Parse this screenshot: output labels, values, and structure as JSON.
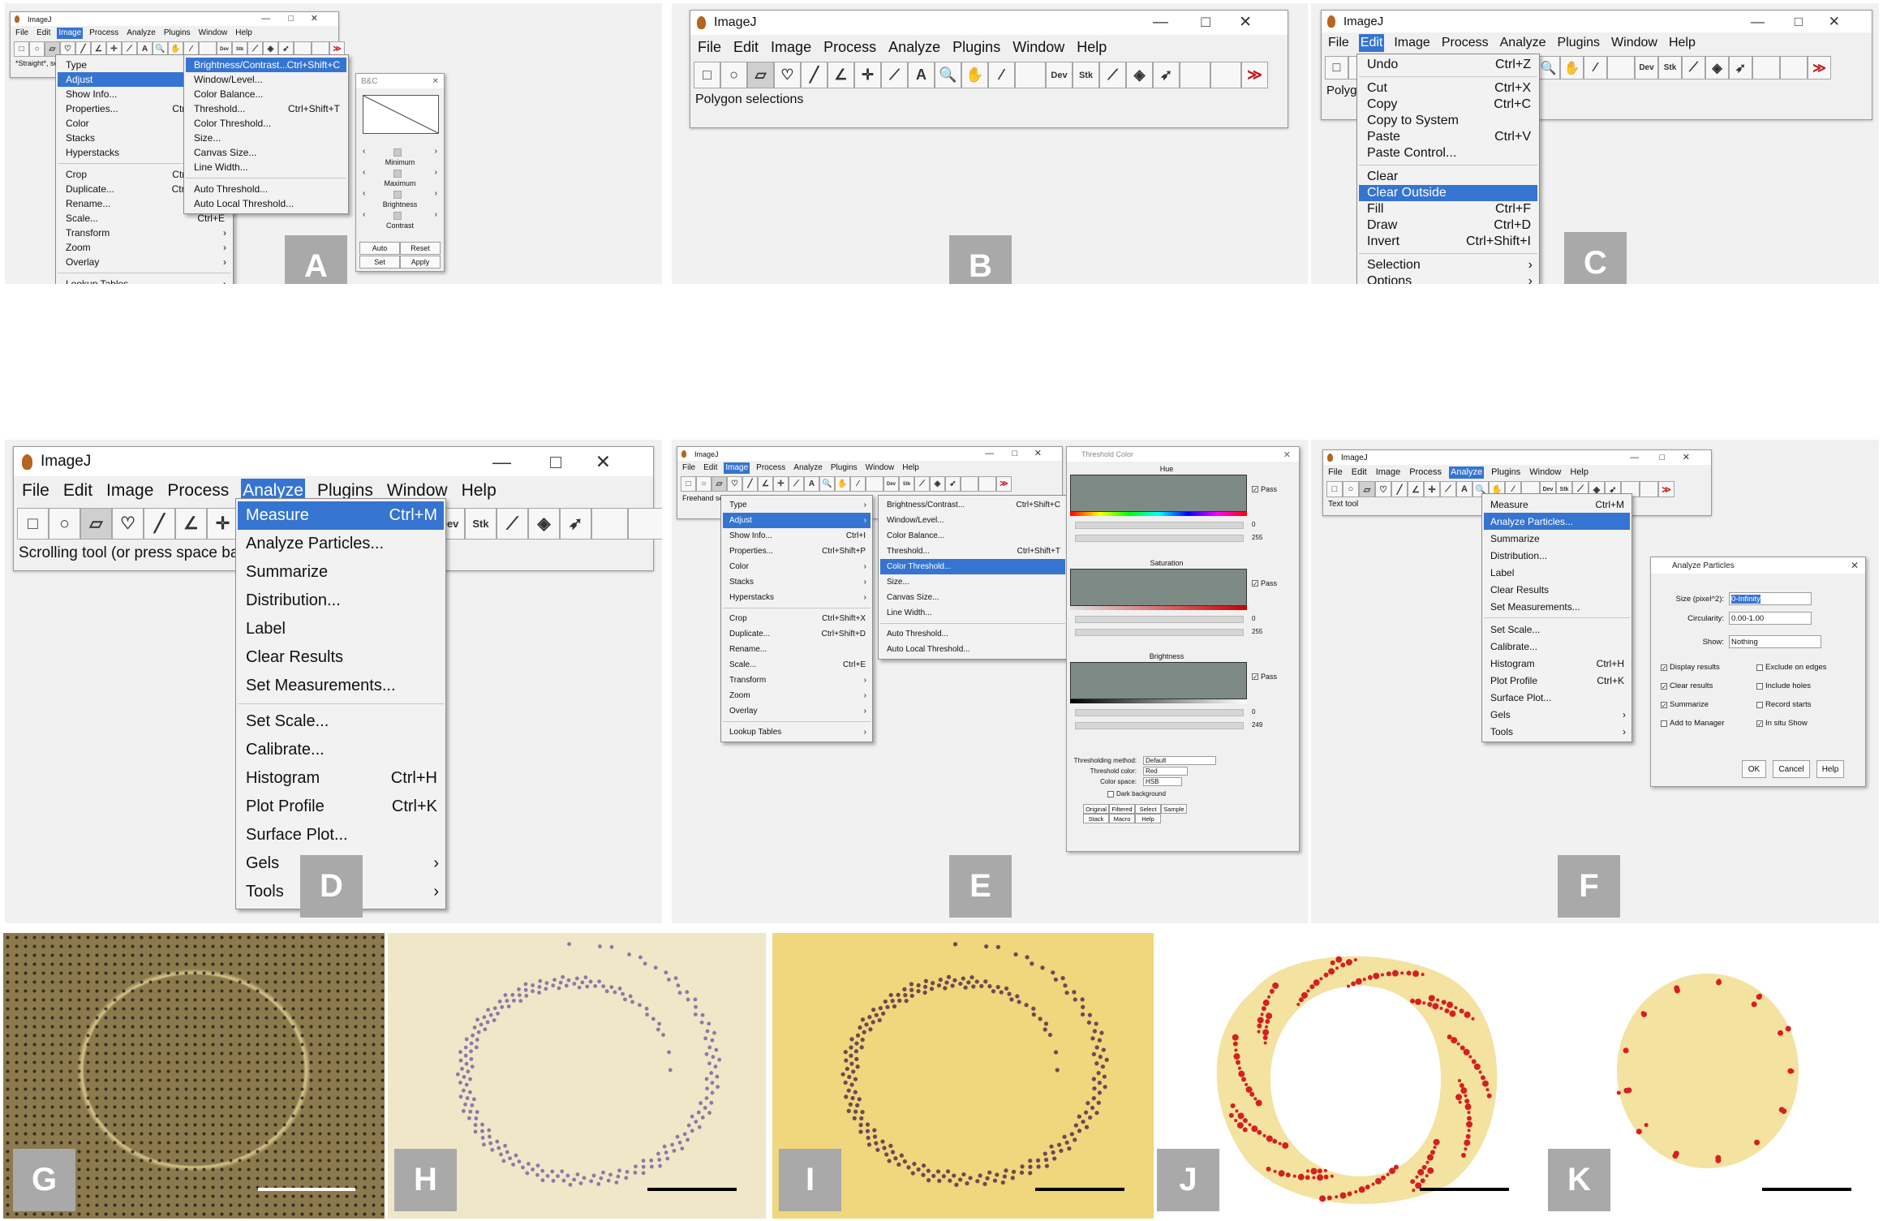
{
  "panels": {
    "a": "A",
    "b": "B",
    "c": "C",
    "d": "D",
    "e": "E",
    "f": "F",
    "g": "G",
    "h": "H",
    "i": "I",
    "j": "J",
    "k": "K"
  },
  "app": {
    "title": "ImageJ",
    "minimize": "—",
    "maximize": "□",
    "close": "✕"
  },
  "menubar": [
    "File",
    "Edit",
    "Image",
    "Process",
    "Analyze",
    "Plugins",
    "Window",
    "Help"
  ],
  "tools": {
    "rect": "□",
    "oval": "○",
    "poly": "▱",
    "freehand": "♡",
    "line": "╱",
    "angle": "∠",
    "point": "✛",
    "wand": "⟋",
    "text": "A",
    "zoom": "🔍",
    "hand": "✋",
    "dropper": "⁄",
    "dev": "Dev",
    "stk": "Stk",
    "brush": "⟋",
    "flood": "◈",
    "pick": "➶",
    "more": "≫"
  },
  "a": {
    "status": "*Straight*, se",
    "image_menu": [
      {
        "label": "Type",
        "arrow": "›"
      },
      {
        "label": "Adjust",
        "arrow": "›",
        "hl": true
      },
      {
        "label": "Show Info...",
        "sc": "Ctrl+I"
      },
      {
        "label": "Properties...",
        "sc": "Ctrl+Shift+P"
      },
      {
        "label": "Color",
        "arrow": "›"
      },
      {
        "label": "Stacks",
        "arrow": "›"
      },
      {
        "label": "Hyperstacks",
        "arrow": "›"
      },
      {
        "sep": true
      },
      {
        "label": "Crop",
        "sc": "Ctrl+Shift+X"
      },
      {
        "label": "Duplicate...",
        "sc": "Ctrl+Shift+D"
      },
      {
        "label": "Rename..."
      },
      {
        "label": "Scale...",
        "sc": "Ctrl+E"
      },
      {
        "label": "Transform",
        "arrow": "›"
      },
      {
        "label": "Zoom",
        "arrow": "›"
      },
      {
        "label": "Overlay",
        "arrow": "›"
      },
      {
        "sep": true
      },
      {
        "label": "Lookup Tables",
        "arrow": "›"
      }
    ],
    "adjust_menu": [
      {
        "label": "Brightness/Contrast...",
        "sc": "Ctrl+Shift+C",
        "hl": true
      },
      {
        "label": "Window/Level..."
      },
      {
        "label": "Color Balance..."
      },
      {
        "label": "Threshold...",
        "sc": "Ctrl+Shift+T"
      },
      {
        "label": "Color Threshold..."
      },
      {
        "label": "Size..."
      },
      {
        "label": "Canvas Size..."
      },
      {
        "label": "Line Width..."
      },
      {
        "sep": true
      },
      {
        "label": "Auto Threshold..."
      },
      {
        "label": "Auto Local Threshold..."
      }
    ],
    "bc": {
      "title": "B&C",
      "minimum": "Minimum",
      "maximum": "Maximum",
      "brightness": "Brightness",
      "contrast": "Contrast",
      "auto": "Auto",
      "reset": "Reset",
      "set": "Set",
      "apply": "Apply",
      "lt": "‹",
      "gt": "›"
    }
  },
  "b": {
    "status": "Polygon selections"
  },
  "c": {
    "status": "Polygo",
    "edit_menu": [
      {
        "label": "Undo",
        "sc": "Ctrl+Z"
      },
      {
        "sep": true
      },
      {
        "label": "Cut",
        "sc": "Ctrl+X"
      },
      {
        "label": "Copy",
        "sc": "Ctrl+C"
      },
      {
        "label": "Copy to System"
      },
      {
        "label": "Paste",
        "sc": "Ctrl+V"
      },
      {
        "label": "Paste Control..."
      },
      {
        "sep": true
      },
      {
        "label": "Clear"
      },
      {
        "label": "Clear Outside",
        "hl": true
      },
      {
        "label": "Fill",
        "sc": "Ctrl+F"
      },
      {
        "label": "Draw",
        "sc": "Ctrl+D"
      },
      {
        "label": "Invert",
        "sc": "Ctrl+Shift+I"
      },
      {
        "sep": true
      },
      {
        "label": "Selection",
        "arrow": "›"
      },
      {
        "label": "Options",
        "arrow": "›"
      }
    ]
  },
  "d": {
    "status": "Scrolling tool (or press space bar a",
    "analyze_menu": [
      {
        "label": "Measure",
        "sc": "Ctrl+M",
        "hl": true
      },
      {
        "label": "Analyze Particles..."
      },
      {
        "label": "Summarize"
      },
      {
        "label": "Distribution..."
      },
      {
        "label": "Label"
      },
      {
        "label": "Clear Results"
      },
      {
        "label": "Set Measurements..."
      },
      {
        "sep": true
      },
      {
        "label": "Set Scale..."
      },
      {
        "label": "Calibrate..."
      },
      {
        "label": "Histogram",
        "sc": "Ctrl+H"
      },
      {
        "label": "Plot Profile",
        "sc": "Ctrl+K"
      },
      {
        "label": "Surface Plot..."
      },
      {
        "label": "Gels",
        "arrow": "›"
      },
      {
        "label": "Tools",
        "arrow": "›"
      }
    ]
  },
  "e": {
    "status": "Freehand sel",
    "image_menu": [
      {
        "label": "Type",
        "arrow": "›"
      },
      {
        "label": "Adjust",
        "arrow": "›",
        "hl": true
      },
      {
        "label": "Show Info...",
        "sc": "Ctrl+I"
      },
      {
        "label": "Properties...",
        "sc": "Ctrl+Shift+P"
      },
      {
        "label": "Color",
        "arrow": "›"
      },
      {
        "label": "Stacks",
        "arrow": "›"
      },
      {
        "label": "Hyperstacks",
        "arrow": "›"
      },
      {
        "sep": true
      },
      {
        "label": "Crop",
        "sc": "Ctrl+Shift+X"
      },
      {
        "label": "Duplicate...",
        "sc": "Ctrl+Shift+D"
      },
      {
        "label": "Rename..."
      },
      {
        "label": "Scale...",
        "sc": "Ctrl+E"
      },
      {
        "label": "Transform",
        "arrow": "›"
      },
      {
        "label": "Zoom",
        "arrow": "›"
      },
      {
        "label": "Overlay",
        "arrow": "›"
      },
      {
        "sep": true
      },
      {
        "label": "Lookup Tables",
        "arrow": "›"
      }
    ],
    "adjust_menu": [
      {
        "label": "Brightness/Contrast...",
        "sc": "Ctrl+Shift+C"
      },
      {
        "label": "Window/Level..."
      },
      {
        "label": "Color Balance..."
      },
      {
        "label": "Threshold...",
        "sc": "Ctrl+Shift+T"
      },
      {
        "label": "Color Threshold...",
        "hl": true
      },
      {
        "label": "Size..."
      },
      {
        "label": "Canvas Size..."
      },
      {
        "label": "Line Width..."
      },
      {
        "sep": true
      },
      {
        "label": "Auto Threshold..."
      },
      {
        "label": "Auto Local Threshold..."
      }
    ],
    "ct": {
      "title": "Threshold Color",
      "hue": "Hue",
      "saturation": "Saturation",
      "brightness": "Brightness",
      "pass": "Pass",
      "zero": "0",
      "v255": "255",
      "v249": "249",
      "method_lbl": "Thresholding method:",
      "method": "Default",
      "color_lbl": "Threshold color:",
      "color": "Red",
      "space_lbl": "Color space:",
      "space": "HSB",
      "dark": "Dark background",
      "b_original": "Original",
      "b_filtered": "Filtered",
      "b_select": "Select",
      "b_sample": "Sample",
      "b_stack": "Stack",
      "b_macro": "Macro",
      "b_help": "Help"
    }
  },
  "f": {
    "status": "Text tool",
    "analyze_menu": [
      {
        "label": "Measure",
        "sc": "Ctrl+M"
      },
      {
        "label": "Analyze Particles...",
        "hl": true
      },
      {
        "label": "Summarize"
      },
      {
        "label": "Distribution..."
      },
      {
        "label": "Label"
      },
      {
        "label": "Clear Results"
      },
      {
        "label": "Set Measurements..."
      },
      {
        "sep": true
      },
      {
        "label": "Set Scale..."
      },
      {
        "label": "Calibrate..."
      },
      {
        "label": "Histogram",
        "sc": "Ctrl+H"
      },
      {
        "label": "Plot Profile",
        "sc": "Ctrl+K"
      },
      {
        "label": "Surface Plot..."
      },
      {
        "label": "Gels",
        "arrow": "›"
      },
      {
        "label": "Tools",
        "arrow": "›"
      }
    ],
    "ap": {
      "title": "Analyze Particles",
      "size_lbl": "Size (pixel^2):",
      "size": "0-Infinity",
      "circ_lbl": "Circularity:",
      "circ": "0.00-1.00",
      "show_lbl": "Show:",
      "show": "Nothing",
      "display": "Display results",
      "exclude": "Exclude on edges",
      "clear": "Clear results",
      "holes": "Include holes",
      "summarize": "Summarize",
      "record": "Record starts",
      "add": "Add to Manager",
      "insitu": "In situ Show",
      "ok": "OK",
      "cancel": "Cancel",
      "help": "Help",
      "check": "✓"
    }
  }
}
